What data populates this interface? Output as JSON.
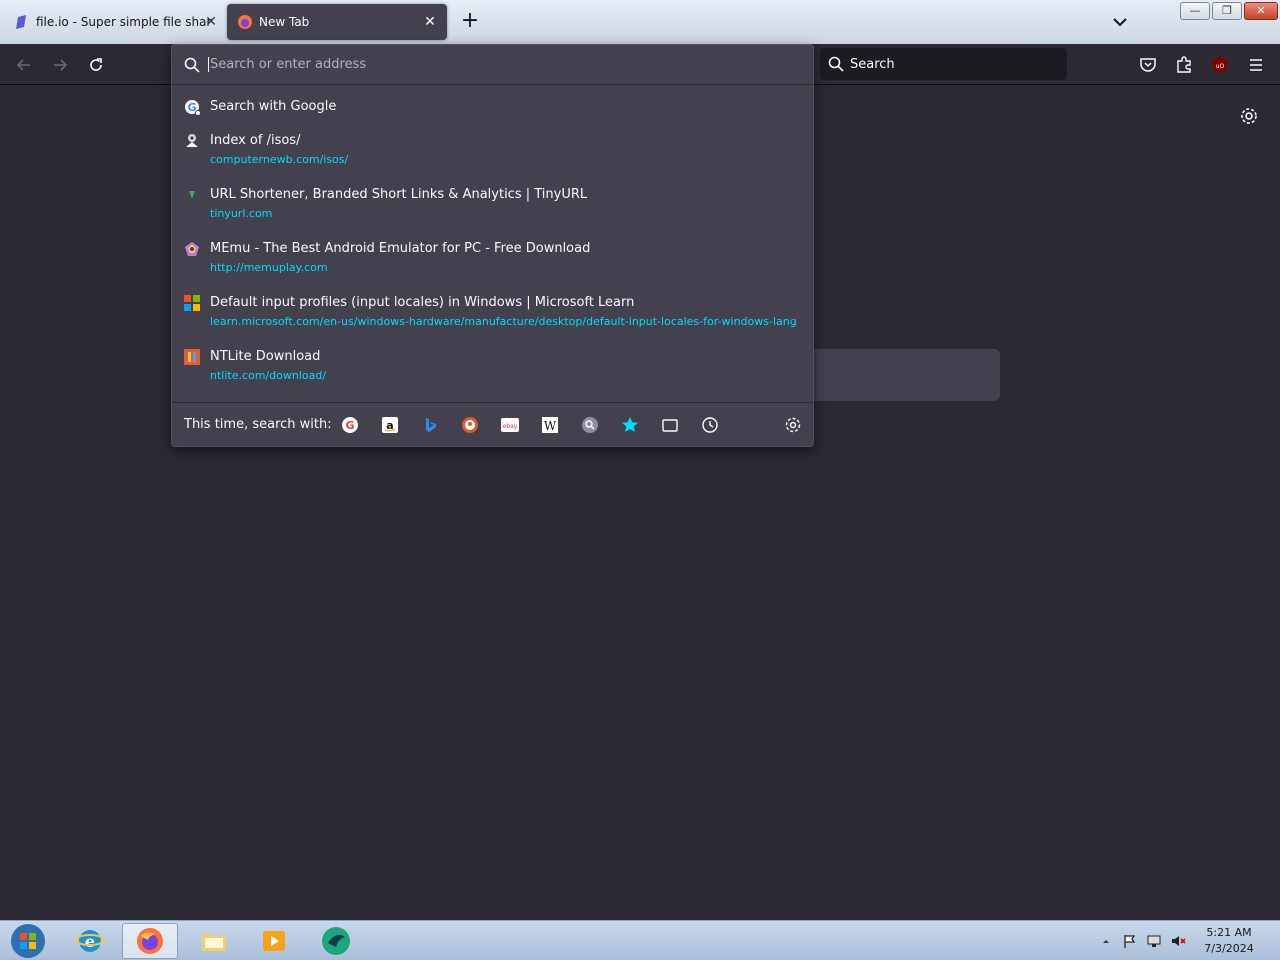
{
  "tabs": [
    {
      "title": "file.io - Super simple file sharing",
      "active": false,
      "close_label": "✕"
    },
    {
      "title": "New Tab",
      "active": true,
      "close_label": "✕"
    }
  ],
  "new_tab_label": "+",
  "window_controls": {
    "minimize": "—",
    "maximize": "❐",
    "close": "✕"
  },
  "search_bar": {
    "placeholder": "Search"
  },
  "urlbar": {
    "placeholder": "Search or enter address",
    "results": [
      {
        "icon": "google-icon",
        "title": "Search with Google",
        "url": ""
      },
      {
        "icon": "isos-icon",
        "title": "Index of /isos/",
        "url": "computernewb.com/isos/"
      },
      {
        "icon": "tinyurl-icon",
        "title": "URL Shortener, Branded Short Links & Analytics | TinyURL",
        "url": "tinyurl.com"
      },
      {
        "icon": "memu-icon",
        "title": "MEmu - The Best Android Emulator for PC - Free Download",
        "url": "http://memuplay.com"
      },
      {
        "icon": "microsoft-icon",
        "title": "Default input profiles (input locales) in Windows | Microsoft Learn",
        "url": "learn.microsoft.com/en-us/windows-hardware/manufacture/desktop/default-input-locales-for-windows-lang..."
      },
      {
        "icon": "ntlite-icon",
        "title": "NTLite Download",
        "url": "ntlite.com/download/"
      }
    ],
    "one_off_label": "This time, search with:",
    "engines": [
      "google-icon",
      "amazon-icon",
      "bing-icon",
      "duckduckgo-icon",
      "ebay-icon",
      "wikipedia-icon",
      "search-engine-icon",
      "bookmarks-icon",
      "tabs-icon",
      "history-icon"
    ]
  },
  "clock": {
    "time": "5:21 AM",
    "date": "7/3/2024"
  },
  "colors": {
    "accent": "#00ddff",
    "panel": "#42414d",
    "background": "#2b2a33"
  }
}
